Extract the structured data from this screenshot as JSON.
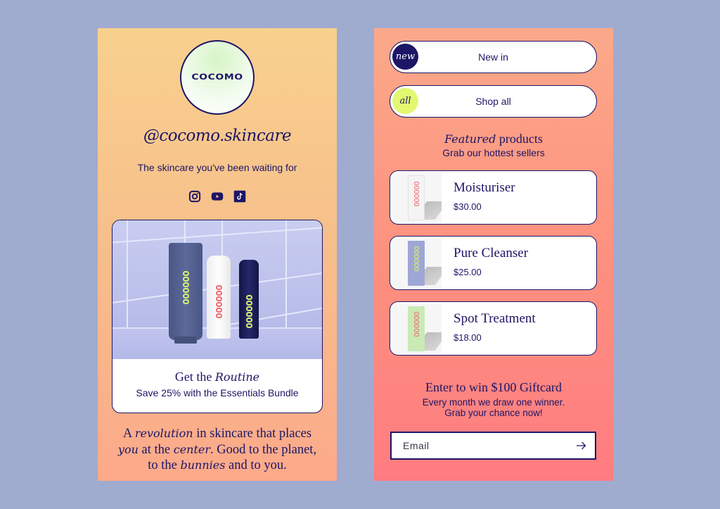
{
  "colors": {
    "page_background": "#a0abd0",
    "ink": "#1d1566",
    "left_panel_gradient": [
      "#f8d18e",
      "#fca98a"
    ],
    "right_panel_gradient": [
      "#fba98a",
      "#ff7c80"
    ],
    "badge_new": "#1d1566",
    "badge_all": "#e3f870"
  },
  "profile": {
    "logo_text": "COCOMO",
    "handle": "@cocomo.skincare",
    "tagline": "The skincare you've been waiting for",
    "socials": [
      {
        "name": "instagram-icon"
      },
      {
        "name": "youtube-icon"
      },
      {
        "name": "tiktok-icon"
      }
    ]
  },
  "routine_card": {
    "title_prefix": "Get the ",
    "title_emphasis": "Routine",
    "subtitle": "Save 25% with the Essentials Bundle"
  },
  "mission": {
    "p1": "A ",
    "e1": "revolution",
    "p2": " in skincare that places ",
    "e2": "you",
    "p3": " at the ",
    "e3": "center",
    "p4": ". Good to the planet, to the ",
    "e4": "bunnies",
    "p5": " and to you."
  },
  "links": [
    {
      "badge": "new",
      "label": "New in"
    },
    {
      "badge": "all",
      "label": "Shop all"
    }
  ],
  "featured": {
    "heading_emphasis": "Featured",
    "heading_rest": " products",
    "subtitle": "Grab our hottest sellers",
    "products": [
      {
        "name": "Moisturiser",
        "price": "$30.00",
        "box_color": "#f4f4f4",
        "accent": "#f06a72"
      },
      {
        "name": "Pure Cleanser",
        "price": "$25.00",
        "box_color": "#9ea6d6",
        "accent": "#e0f56c"
      },
      {
        "name": "Spot Treatment",
        "price": "$18.00",
        "box_color": "#c9eab5",
        "accent": "#f06a72"
      }
    ]
  },
  "giftcard": {
    "title": "Enter to win $100 Giftcard",
    "line1": "Every month we draw one winner.",
    "line2": "Grab your chance now!",
    "email_placeholder": "Email"
  }
}
